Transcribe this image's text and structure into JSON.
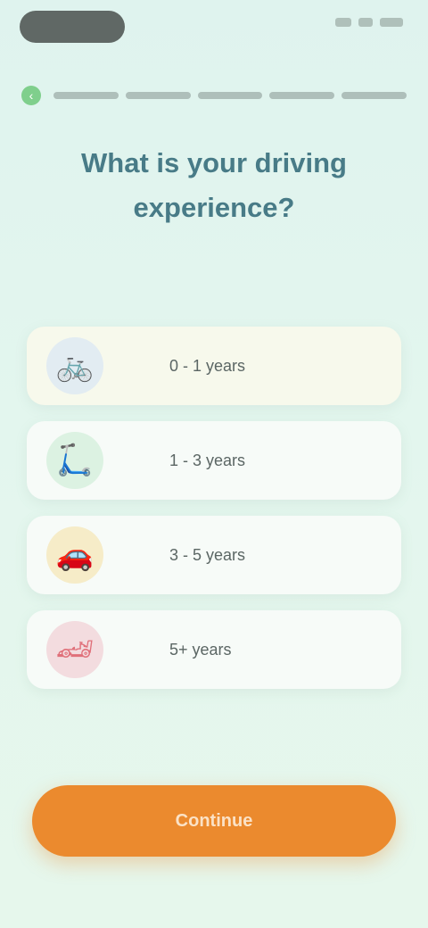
{
  "status_bar": {
    "icons": [
      "signal-icon",
      "wifi-icon",
      "battery-icon"
    ]
  },
  "progress": {
    "steps_total": 5,
    "steps_done": 5
  },
  "question": "What is your driving experience?",
  "options": [
    {
      "label": "0 - 1 years",
      "icon": "bicycle-icon",
      "color": "#8fb4d0"
    },
    {
      "label": "1 - 3 years",
      "icon": "scooter-icon",
      "color": "#6fcf8a"
    },
    {
      "label": "3 - 5 years",
      "icon": "car-icon",
      "color": "#f1c24e"
    },
    {
      "label": "5+ years",
      "icon": "racecar-icon",
      "color": "#e0707a"
    }
  ],
  "continue_label": "Continue",
  "colors": {
    "accent": "#eb8a2e",
    "title": "#2e6676",
    "background": "#e0f4ee"
  }
}
